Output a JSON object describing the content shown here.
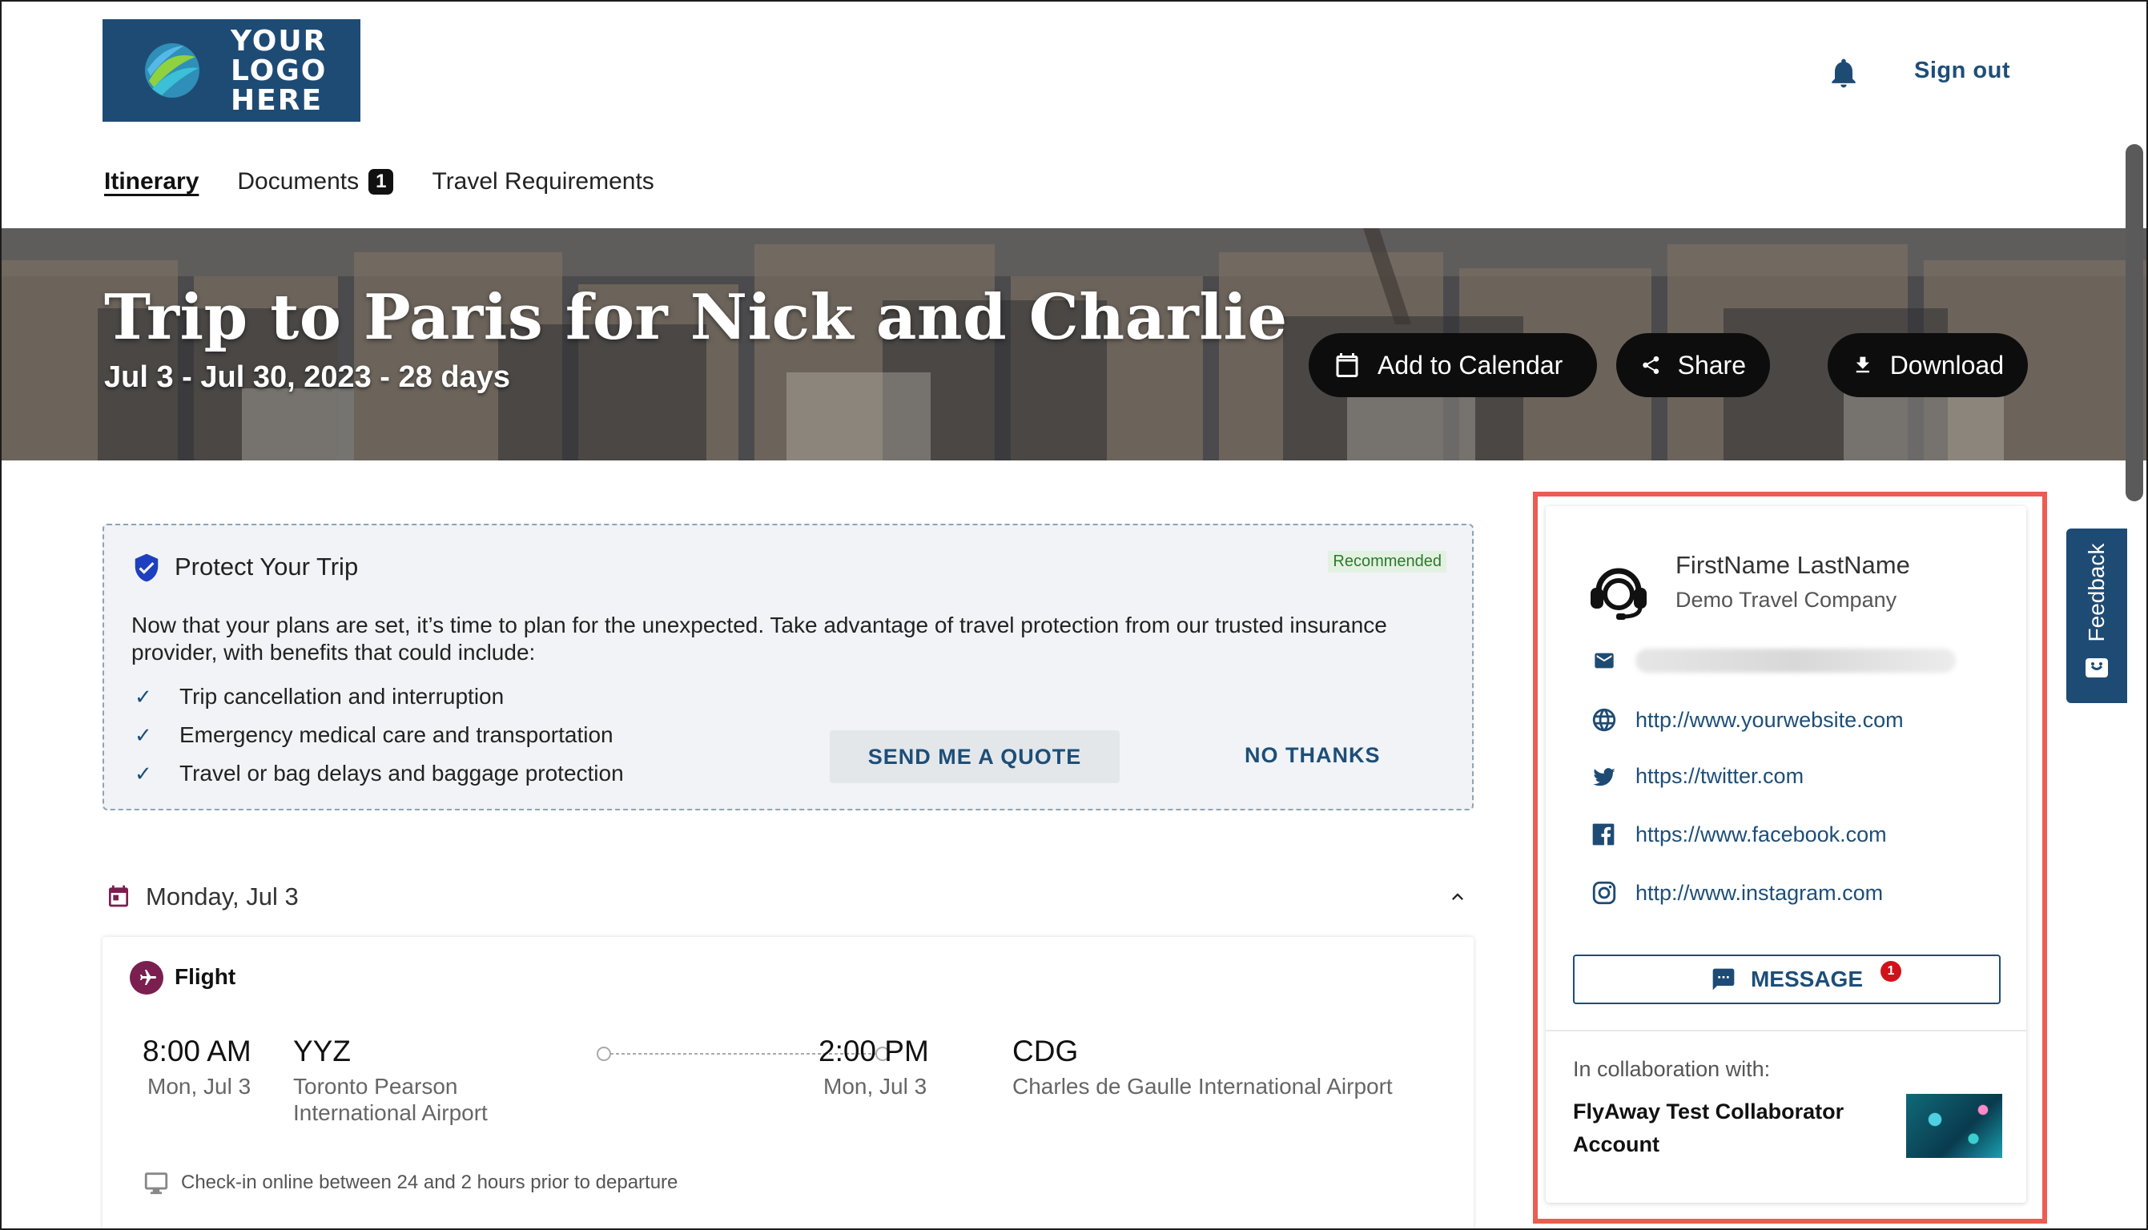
{
  "header": {
    "logo_lines": [
      "YOUR",
      "LOGO",
      "HERE"
    ],
    "signout_label": "Sign out"
  },
  "nav": {
    "items": [
      {
        "label": "Itinerary",
        "active": true
      },
      {
        "label": "Documents",
        "badge": "1"
      },
      {
        "label": "Travel Requirements"
      }
    ]
  },
  "banner": {
    "title": "Trip to Paris for Nick and Charlie",
    "dates": "Jul 3 - Jul 30, 2023 - 28 days",
    "actions": {
      "calendar_label": "Add to Calendar",
      "share_label": "Share",
      "download_label": "Download"
    }
  },
  "protect": {
    "title": "Protect Your Trip",
    "badge": "Recommended",
    "description": "Now that your plans are set, it’s time to plan for the unexpected. Take advantage of travel protection from our trusted insurance provider, with benefits that could include:",
    "benefits": [
      "Trip cancellation and interruption",
      "Emergency medical care and transportation",
      "Travel or bag delays and baggage protection"
    ],
    "quote_label": "SEND ME A QUOTE",
    "decline_label": "NO THANKS"
  },
  "day": {
    "label": "Monday, Jul 3"
  },
  "flight": {
    "type_label": "Flight",
    "depart_time": "8:00 AM",
    "depart_date": "Mon, Jul 3",
    "depart_code": "YYZ",
    "depart_airport_line1": "Toronto Pearson",
    "depart_airport_line2": "International Airport",
    "arrive_time": "2:00 PM",
    "arrive_date": "Mon, Jul 3",
    "arrive_code": "CDG",
    "arrive_airport": "Charles de Gaulle International Airport",
    "checkin_note": "Check-in online between 24 and 2 hours prior to departure"
  },
  "agent": {
    "name": "FirstName LastName",
    "company": "Demo Travel Company",
    "website": "http://www.yourwebsite.com",
    "twitter": "https://twitter.com",
    "facebook": "https://www.facebook.com",
    "instagram": "http://www.instagram.com",
    "message_label": "MESSAGE",
    "message_badge": "1",
    "collab_label": "In collaboration with:",
    "collab_name": "FlyAway Test Collaborator Account"
  },
  "feedback": {
    "label": "Feedback"
  },
  "colors": {
    "brand": "#1e4b74",
    "link": "#1d4e79",
    "highlight": "#ec5c52",
    "badge_red": "#d0121b"
  }
}
